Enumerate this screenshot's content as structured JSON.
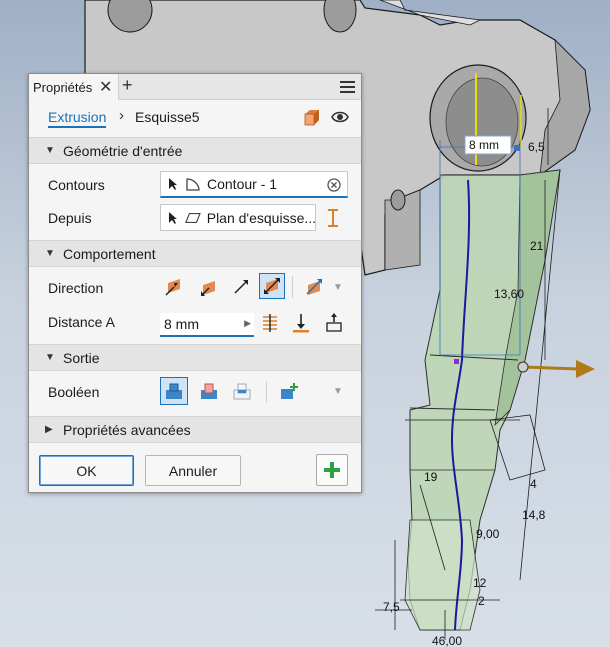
{
  "viewport": {
    "dimensions": {
      "d1": "8 mm",
      "d2": "6,5",
      "d3": "21",
      "d4": "13,60",
      "d5": "19",
      "d6": "9,00",
      "d7": "4",
      "d8": "14,8",
      "d9": "12",
      "d10": "2",
      "d11": "7,5",
      "d12": "46,00"
    }
  },
  "panel": {
    "tab_label": "Propriétés",
    "tab_close": "✕",
    "tab_add": "+",
    "breadcrumb": {
      "parent": "Extrusion",
      "separator": "›",
      "current": "Esquisse5"
    },
    "sections": {
      "input_geometry": "Géométrie d'entrée",
      "behavior": "Comportement",
      "output": "Sortie",
      "advanced": "Propriétés avancées"
    },
    "fields": {
      "profiles_label": "Contours",
      "profiles_value": "Contour - 1",
      "from_label": "Depuis",
      "from_value": "Plan d'esquisse...",
      "direction_label": "Direction",
      "distance_label": "Distance A",
      "distance_value": "8 mm",
      "boolean_label": "Booléen"
    },
    "buttons": {
      "ok": "OK",
      "cancel": "Annuler"
    }
  },
  "colors": {
    "accent": "#1a73b8",
    "part_gray": "#c7c7c7",
    "preview_green": "#b9d3b0",
    "direction_orange": "#e38a52",
    "apply_green": "#2f9e44"
  },
  "icons": {
    "cursor": "cursor-arrow-icon",
    "profile": "profile-shape-icon",
    "plane": "plane-icon",
    "flip": "flip-icon",
    "extrusion": "extrusion-box-icon",
    "visibility": "eye-icon",
    "menu": "hamburger-menu-icon"
  }
}
